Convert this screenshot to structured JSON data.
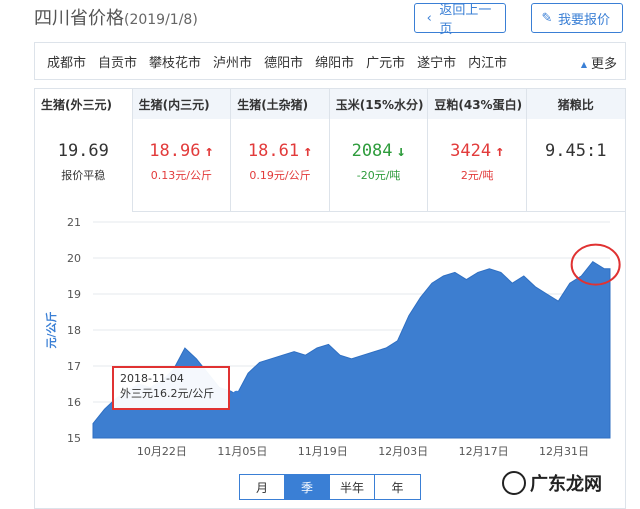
{
  "header": {
    "title": "四川省价格",
    "date": "(2019/1/8)",
    "back_label": "返回上一页",
    "report_label": "我要报价"
  },
  "cities": [
    "成都市",
    "自贡市",
    "攀枝花市",
    "泸州市",
    "德阳市",
    "绵阳市",
    "广元市",
    "遂宁市",
    "内江市"
  ],
  "more_label": "更多",
  "cards": [
    {
      "name": "生猪(外三元)",
      "value": "19.69",
      "sub": "报价平稳",
      "trend": "flat"
    },
    {
      "name": "生猪(内三元)",
      "value": "18.96",
      "sub": "0.13元/公斤",
      "trend": "up"
    },
    {
      "name": "生猪(土杂猪)",
      "value": "18.61",
      "sub": "0.19元/公斤",
      "trend": "up"
    },
    {
      "name": "玉米(15%水分)",
      "value": "2084",
      "sub": "-20元/吨",
      "trend": "down"
    },
    {
      "name": "豆粕(43%蛋白)",
      "value": "3424",
      "sub": "2元/吨",
      "trend": "up"
    },
    {
      "name": "猪粮比",
      "value": "9.45:1",
      "sub": "",
      "trend": "flat"
    }
  ],
  "colors": {
    "accent": "#3a7fd5",
    "up": "#e23b3b",
    "down": "#2e9c3c",
    "area": "#3d7ed0",
    "highlight": "#e03232"
  },
  "chart_data": {
    "type": "area",
    "ylabel": "元/公斤",
    "ylim": [
      15,
      21
    ],
    "yticks": [
      15,
      16,
      17,
      18,
      19,
      20,
      21
    ],
    "xticks": [
      "10月22日",
      "11月05日",
      "11月19日",
      "12月03日",
      "12月17日",
      "12月31日"
    ],
    "grid": true,
    "dates": [
      "2018-10-10",
      "2018-10-12",
      "2018-10-14",
      "2018-10-16",
      "2018-10-18",
      "2018-10-20",
      "2018-10-22",
      "2018-10-24",
      "2018-10-26",
      "2018-10-28",
      "2018-10-30",
      "2018-11-01",
      "2018-11-03",
      "2018-11-04",
      "2018-11-06",
      "2018-11-08",
      "2018-11-10",
      "2018-11-12",
      "2018-11-14",
      "2018-11-16",
      "2018-11-18",
      "2018-11-20",
      "2018-11-22",
      "2018-11-24",
      "2018-11-26",
      "2018-11-28",
      "2018-11-30",
      "2018-12-02",
      "2018-12-04",
      "2018-12-06",
      "2018-12-08",
      "2018-12-10",
      "2018-12-12",
      "2018-12-14",
      "2018-12-16",
      "2018-12-18",
      "2018-12-20",
      "2018-12-22",
      "2018-12-24",
      "2018-12-26",
      "2018-12-28",
      "2018-12-30",
      "2019-01-01",
      "2019-01-03",
      "2019-01-05",
      "2019-01-07",
      "2019-01-08"
    ],
    "values": [
      15.4,
      15.8,
      16.1,
      16.3,
      16.5,
      16.4,
      16.6,
      16.9,
      17.5,
      17.2,
      16.8,
      16.4,
      16.3,
      16.2,
      16.8,
      17.1,
      17.2,
      17.3,
      17.4,
      17.3,
      17.5,
      17.6,
      17.3,
      17.2,
      17.3,
      17.4,
      17.5,
      17.7,
      18.4,
      18.9,
      19.3,
      19.5,
      19.6,
      19.4,
      19.6,
      19.7,
      19.6,
      19.3,
      19.5,
      19.2,
      19.0,
      18.8,
      19.3,
      19.5,
      19.9,
      19.7,
      19.7
    ],
    "tooltip": {
      "date": "2018-11-04",
      "text": "外三元16.2元/公斤"
    }
  },
  "periods": [
    "月",
    "季",
    "半年",
    "年"
  ],
  "selected_period": "季",
  "watermark": {
    "text": "广东龙网"
  }
}
